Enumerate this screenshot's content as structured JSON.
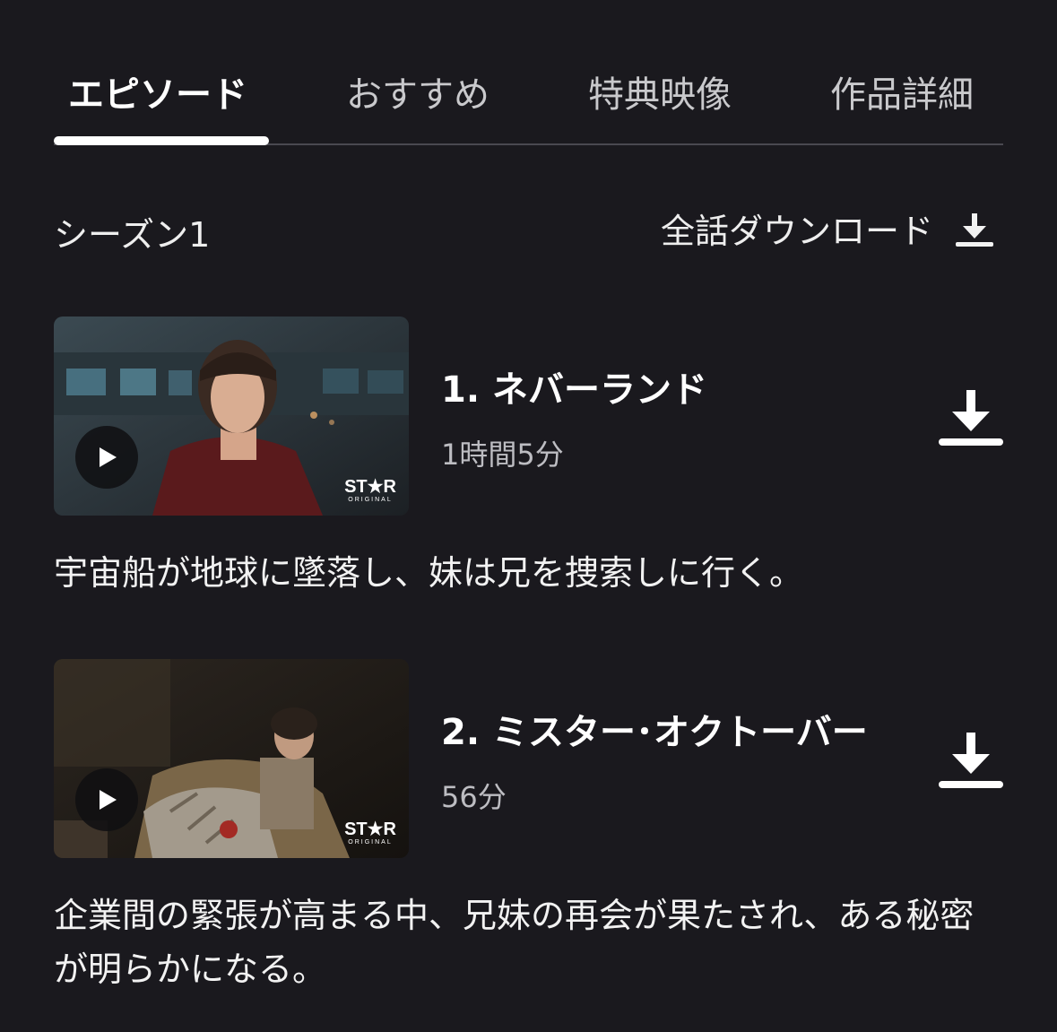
{
  "tabs": [
    {
      "label": "エピソード"
    },
    {
      "label": "おすすめ"
    },
    {
      "label": "特典映像"
    },
    {
      "label": "作品詳細"
    }
  ],
  "season": {
    "label": "シーズン1",
    "download_all_label": "全話ダウンロード"
  },
  "badge": {
    "top": "ST★R",
    "bottom": "ORIGINAL"
  },
  "episodes": [
    {
      "title": "1. ネバーランド",
      "duration": "1時間5分",
      "description": "宇宙船が地球に墜落し、妹は兄を捜索しに行く。"
    },
    {
      "title": "2. ミスター･オクトーバー",
      "duration": "56分",
      "description": "企業間の緊張が高まる中、兄妹の再会が果たされ、ある秘密が明らかになる。"
    }
  ],
  "icons": {
    "download": "download-icon",
    "play": "play-icon"
  },
  "colors": {
    "background": "#1a191e",
    "active_tab": "#ffffff",
    "inactive_tab": "#c9c9cc",
    "secondary_text": "#bdbdc2"
  }
}
